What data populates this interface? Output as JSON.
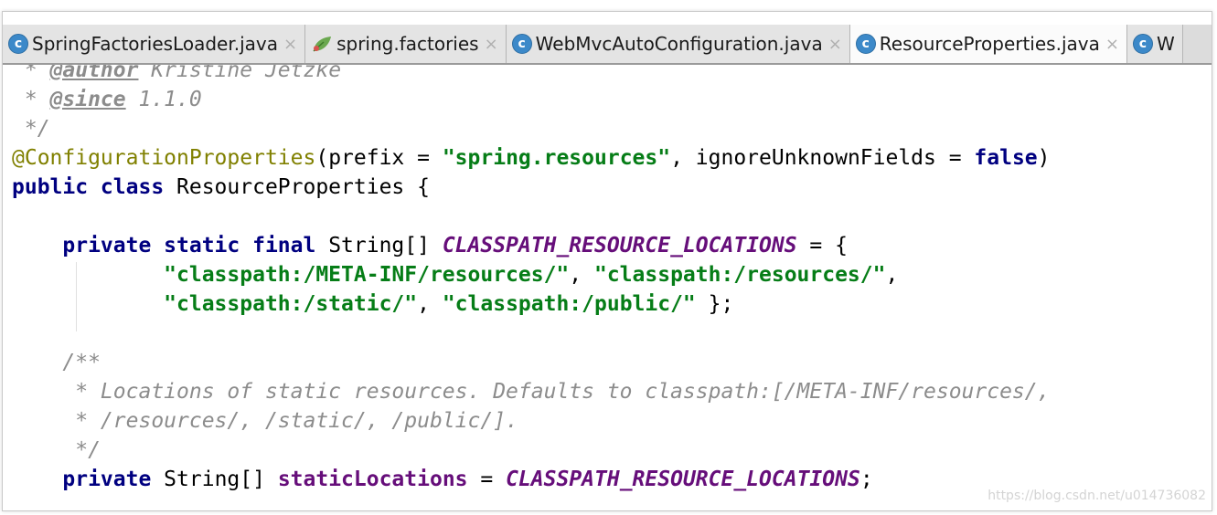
{
  "tabs": [
    {
      "label": "SpringFactoriesLoader.java",
      "icon": "c-class-icon",
      "active": false
    },
    {
      "label": "spring.factories",
      "icon": "spring-leaf-icon",
      "active": false
    },
    {
      "label": "WebMvcAutoConfiguration.java",
      "icon": "c-class-icon",
      "active": false
    },
    {
      "label": "ResourceProperties.java",
      "icon": "c-class-icon",
      "active": true
    },
    {
      "label": "W",
      "icon": "c-class-icon",
      "active": false
    }
  ],
  "tab_close_glyph": "×",
  "class_icon_letter": "c",
  "code": {
    "l1_prefix": " * ",
    "l1_tag": "@author",
    "l1_text": " Kristine Jetzke",
    "l2_prefix": " * ",
    "l2_tag": "@since",
    "l2_text": " 1.1.0",
    "l3": " */",
    "l4_ann": "@ConfigurationProperties",
    "l4_a": "(prefix = ",
    "l4_str": "\"spring.resources\"",
    "l4_b": ", ignoreUnknownFields = ",
    "l4_kw": "false",
    "l4_c": ")",
    "l5_kw": "public class",
    "l5_text": " ResourceProperties {",
    "l7_indent": "    ",
    "l7_kw": "private static final",
    "l7_type": " String[] ",
    "l7_const": "CLASSPATH_RESOURCE_LOCATIONS",
    "l7_rest": " = {",
    "l8_indent": "            ",
    "l8_s1": "\"classpath:/META-INF/resources/\"",
    "l8_sep": ", ",
    "l8_s2": "\"classpath:/resources/\"",
    "l8_end": ",",
    "l9_indent": "            ",
    "l9_s1": "\"classpath:/static/\"",
    "l9_sep": ", ",
    "l9_s2": "\"classpath:/public/\"",
    "l9_end": " };",
    "l11": "    /**",
    "l12": "     * Locations of static resources. Defaults to classpath:[/META-INF/resources/,",
    "l13": "     * /resources/, /static/, /public/].",
    "l14": "     */",
    "l15_indent": "    ",
    "l15_kw": "private",
    "l15_type": " String[] ",
    "l15_fld": "staticLocations",
    "l15_eq": " = ",
    "l15_const": "CLASSPATH_RESOURCE_LOCATIONS",
    "l15_end": ";"
  },
  "watermark": "https://blog.csdn.net/u014736082",
  "colors": {
    "keyword": "#000080",
    "string": "#067d17",
    "annotation": "#808000",
    "constant": "#660e7a",
    "comment": "#8c8c8c",
    "class_icon": "#3c89c9"
  }
}
